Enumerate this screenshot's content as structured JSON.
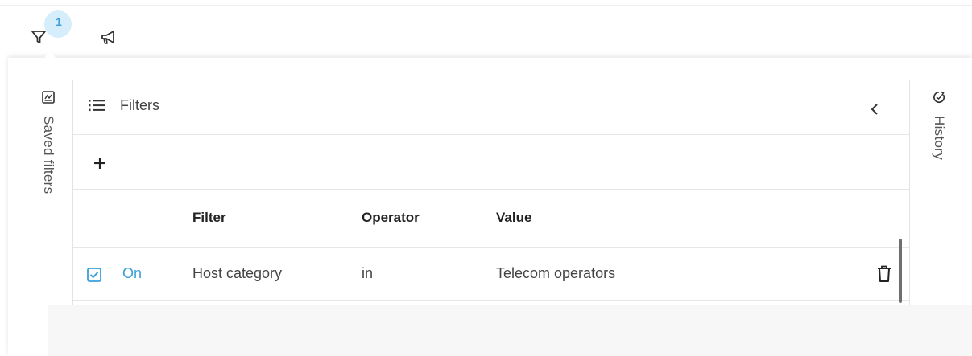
{
  "toolbar": {
    "filter_icon": "filter-funnel-icon",
    "active_filter_count": "1",
    "announcement_icon": "megaphone-icon"
  },
  "left_sidebar": {
    "icon": "saved-filters-icon",
    "label": "Saved filters"
  },
  "right_sidebar": {
    "icon": "history-icon",
    "label": "History"
  },
  "filters_panel": {
    "header_icon": "list-icon",
    "title": "Filters",
    "collapse_icon": "chevron-left-icon",
    "add_icon": "plus-icon",
    "columns": [
      "Filter",
      "Operator",
      "Value"
    ],
    "rows": [
      {
        "enabled": true,
        "state_label": "On",
        "filter": "Host category",
        "operator": "in",
        "value": "Telecom operators",
        "delete_icon": "trash-icon"
      }
    ]
  },
  "colors": {
    "accent": "#3a9fdb",
    "badge_bg": "#d6eefb",
    "text": "#444444",
    "border": "#e6e6e6"
  }
}
